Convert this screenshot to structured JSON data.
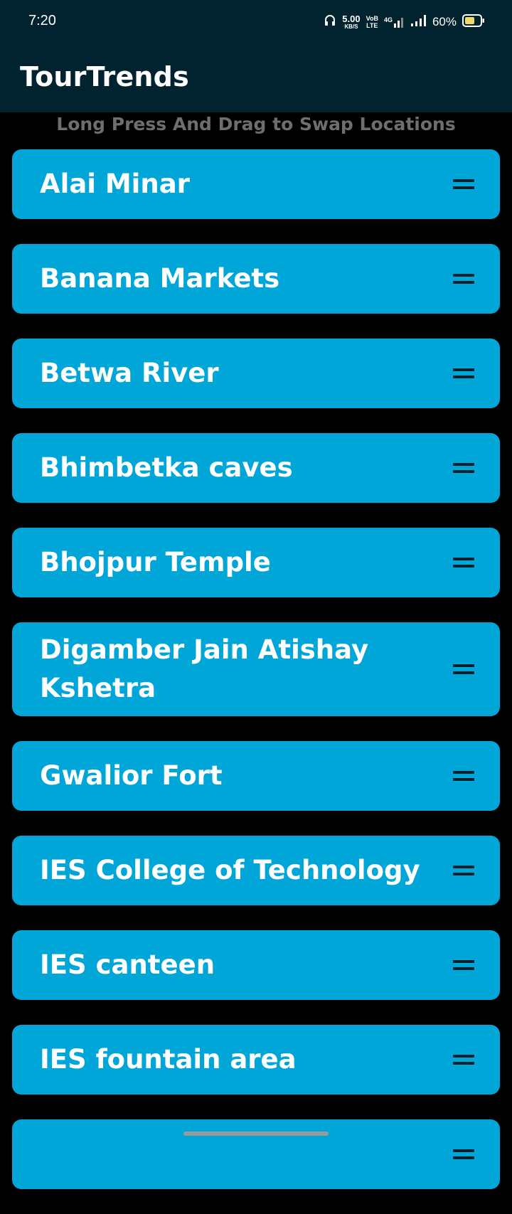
{
  "status_bar": {
    "time": "7:20",
    "net_speed_value": "5.00",
    "net_speed_unit": "KB/S",
    "volte_top": "VoB",
    "volte_bottom": "LTE",
    "network_type": "4G",
    "battery_percent": "60%",
    "battery_level": 0.6,
    "battery_color": "#f5d76e"
  },
  "app_bar": {
    "title": "TourTrends",
    "background": "#01232f"
  },
  "hint": "Long Press And Drag to Swap Locations",
  "accent_color": "#01a6d8",
  "locations": [
    {
      "name": "Alai Minar",
      "handle_icon": "drag-handle-icon"
    },
    {
      "name": "Banana Markets",
      "handle_icon": "drag-handle-icon"
    },
    {
      "name": "Betwa River",
      "handle_icon": "drag-handle-icon"
    },
    {
      "name": "Bhimbetka caves",
      "handle_icon": "drag-handle-icon"
    },
    {
      "name": "Bhojpur Temple",
      "handle_icon": "drag-handle-icon"
    },
    {
      "name": "Digamber Jain Atishay Kshetra",
      "handle_icon": "drag-handle-icon"
    },
    {
      "name": "Gwalior Fort",
      "handle_icon": "drag-handle-icon"
    },
    {
      "name": "IES College of Technology",
      "handle_icon": "drag-handle-icon"
    },
    {
      "name": "IES canteen",
      "handle_icon": "drag-handle-icon"
    },
    {
      "name": "IES fountain area",
      "handle_icon": "drag-handle-icon"
    },
    {
      "name": "",
      "handle_icon": "drag-handle-icon"
    }
  ]
}
